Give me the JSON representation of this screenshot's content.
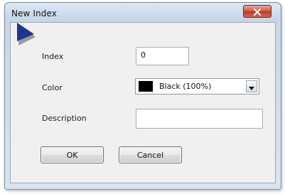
{
  "window": {
    "title": "New Index",
    "close_icon": "close-icon"
  },
  "form": {
    "index_label": "Index",
    "index_value": "0",
    "color_label": "Color",
    "color_value": "Black (100%)",
    "color_swatch": "#000000",
    "description_label": "Description",
    "description_value": ""
  },
  "buttons": {
    "ok_label": "OK",
    "cancel_label": "Cancel"
  },
  "colors": {
    "close_button": "#c94a33",
    "logo_blue": "#20338f",
    "logo_gray": "#8a8a8a"
  }
}
